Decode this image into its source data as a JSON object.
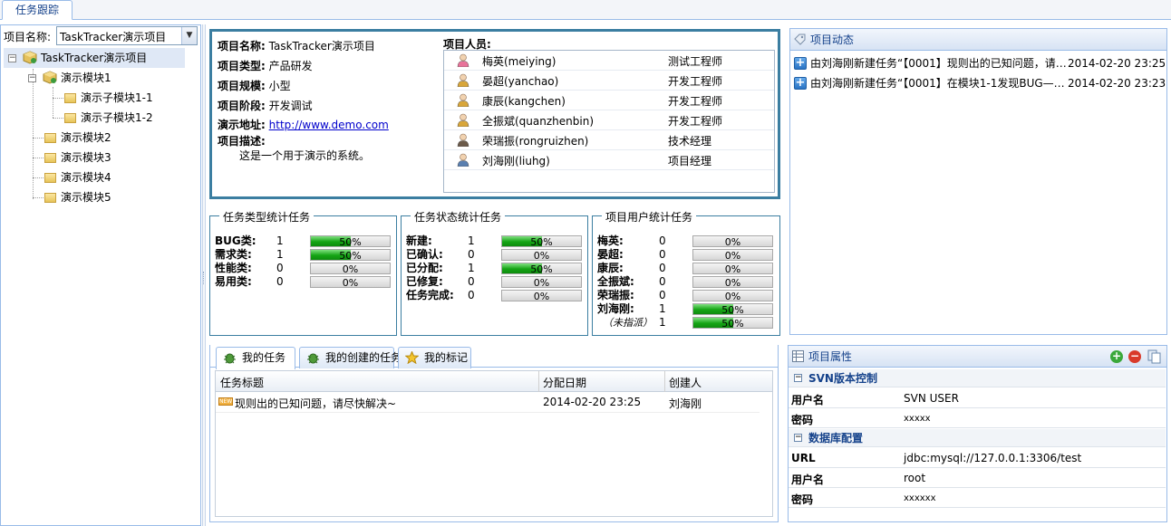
{
  "top_tab": "任务跟踪",
  "project_selector": {
    "label": "项目名称:",
    "value": "TaskTracker演示项目"
  },
  "tree": {
    "root": "TaskTracker演示项目",
    "module1": "演示模块1",
    "sub1": "演示子模块1-1",
    "sub2": "演示子模块1-2",
    "module2": "演示模块2",
    "module3": "演示模块3",
    "module4": "演示模块4",
    "module5": "演示模块5"
  },
  "project_info": {
    "name_label": "项目名称:",
    "name": "TaskTracker演示项目",
    "type_label": "项目类型:",
    "type": "产品研发",
    "scale_label": "项目规模:",
    "scale": "小型",
    "stage_label": "项目阶段:",
    "stage": "开发调试",
    "url_label": "演示地址:",
    "url": "http://www.demo.com",
    "desc_label": "项目描述:",
    "desc": "这是一个用于演示的系统。",
    "members_label": "项目人员:"
  },
  "members": [
    {
      "name": "梅英(meiying)",
      "role": "测试工程师",
      "color": "#e8739a"
    },
    {
      "name": "晏超(yanchao)",
      "role": "开发工程师",
      "color": "#d8a63a"
    },
    {
      "name": "康辰(kangchen)",
      "role": "开发工程师",
      "color": "#d8a63a"
    },
    {
      "name": "全振斌(quanzhenbin)",
      "role": "开发工程师",
      "color": "#d8a63a"
    },
    {
      "name": "荣瑞振(rongruizhen)",
      "role": "技术经理",
      "color": "#6b5a4a"
    },
    {
      "name": "刘海刚(liuhg)",
      "role": "项目经理",
      "color": "#5a7fb0"
    }
  ],
  "stats_type": {
    "title": "任务类型统计任务",
    "rows": [
      {
        "label": "BUG类:",
        "count": "1",
        "pct": 50,
        "pct_text": "50%"
      },
      {
        "label": "需求类:",
        "count": "1",
        "pct": 50,
        "pct_text": "50%"
      },
      {
        "label": "性能类:",
        "count": "0",
        "pct": 0,
        "pct_text": "0%"
      },
      {
        "label": "易用类:",
        "count": "0",
        "pct": 0,
        "pct_text": "0%"
      }
    ]
  },
  "stats_status": {
    "title": "任务状态统计任务",
    "rows": [
      {
        "label": "新建:",
        "count": "1",
        "pct": 50,
        "pct_text": "50%"
      },
      {
        "label": "已确认:",
        "count": "0",
        "pct": 0,
        "pct_text": "0%"
      },
      {
        "label": "已分配:",
        "count": "1",
        "pct": 50,
        "pct_text": "50%"
      },
      {
        "label": "已修复:",
        "count": "0",
        "pct": 0,
        "pct_text": "0%"
      },
      {
        "label": "任务完成:",
        "count": "0",
        "pct": 0,
        "pct_text": "0%"
      }
    ]
  },
  "stats_user": {
    "title": "项目用户统计任务",
    "rows": [
      {
        "label": "梅英:",
        "count": "0",
        "pct": 0,
        "pct_text": "0%"
      },
      {
        "label": "晏超:",
        "count": "0",
        "pct": 0,
        "pct_text": "0%"
      },
      {
        "label": "康辰:",
        "count": "0",
        "pct": 0,
        "pct_text": "0%"
      },
      {
        "label": "全振斌:",
        "count": "0",
        "pct": 0,
        "pct_text": "0%"
      },
      {
        "label": "荣瑞振:",
        "count": "0",
        "pct": 0,
        "pct_text": "0%"
      },
      {
        "label": "刘海刚:",
        "count": "1",
        "pct": 50,
        "pct_text": "50%"
      },
      {
        "label": "（未指派）",
        "count": "1",
        "pct": 50,
        "pct_text": "50%"
      }
    ]
  },
  "tabs": {
    "my_tasks": "我的任务",
    "created": "我的创建的任务",
    "marked": "我的标记"
  },
  "grid": {
    "col_title": "任务标题",
    "col_date": "分配日期",
    "col_creator": "创建人",
    "rows": [
      {
        "badge": "NEW",
        "title": "现则出的已知问题，请尽快解决~",
        "date": "2014-02-20 23:25",
        "creator": "刘海刚"
      }
    ]
  },
  "activity": {
    "title": "项目动态",
    "items": [
      {
        "text": "由刘海刚新建任务“【0001】现则出的已知问题，请…",
        "time": "2014-02-20 23:25"
      },
      {
        "text": "由刘海刚新建任务“【0001】在模块1-1发现BUG—…",
        "time": "2014-02-20 23:23"
      }
    ]
  },
  "properties": {
    "title": "项目属性",
    "svn_group": "SVN版本控制",
    "svn_user_key": "用户名",
    "svn_user_val": "SVN USER",
    "svn_pwd_key": "密码",
    "svn_pwd_val": "xxxxx",
    "db_group": "数据库配置",
    "db_url_key": "URL",
    "db_url_val": "jdbc:mysql://127.0.0.1:3306/test",
    "db_user_key": "用户名",
    "db_user_val": "root",
    "db_pwd_key": "密码",
    "db_pwd_val": "xxxxxx"
  }
}
